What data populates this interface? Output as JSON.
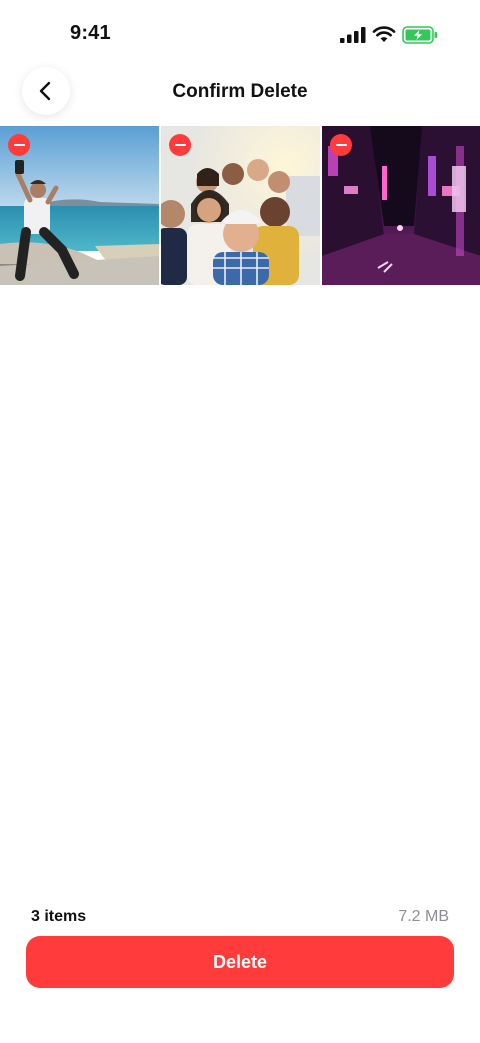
{
  "status_bar": {
    "time": "9:41"
  },
  "header": {
    "title": "Confirm Delete",
    "back_icon": "chevron-left-icon"
  },
  "selected_photos": [
    {
      "description_icon": "photo-selfie-seaside",
      "remove_icon": "minus-circle-icon"
    },
    {
      "description_icon": "photo-group-selfie",
      "remove_icon": "minus-circle-icon"
    },
    {
      "description_icon": "photo-neon-street",
      "remove_icon": "minus-circle-icon"
    }
  ],
  "summary": {
    "count": "3 items",
    "size": "7.2 MB"
  },
  "actions": {
    "delete_label": "Delete"
  },
  "colors": {
    "danger": "#ff3b3b",
    "battery": "#34c759",
    "muted": "#8e8e93"
  }
}
